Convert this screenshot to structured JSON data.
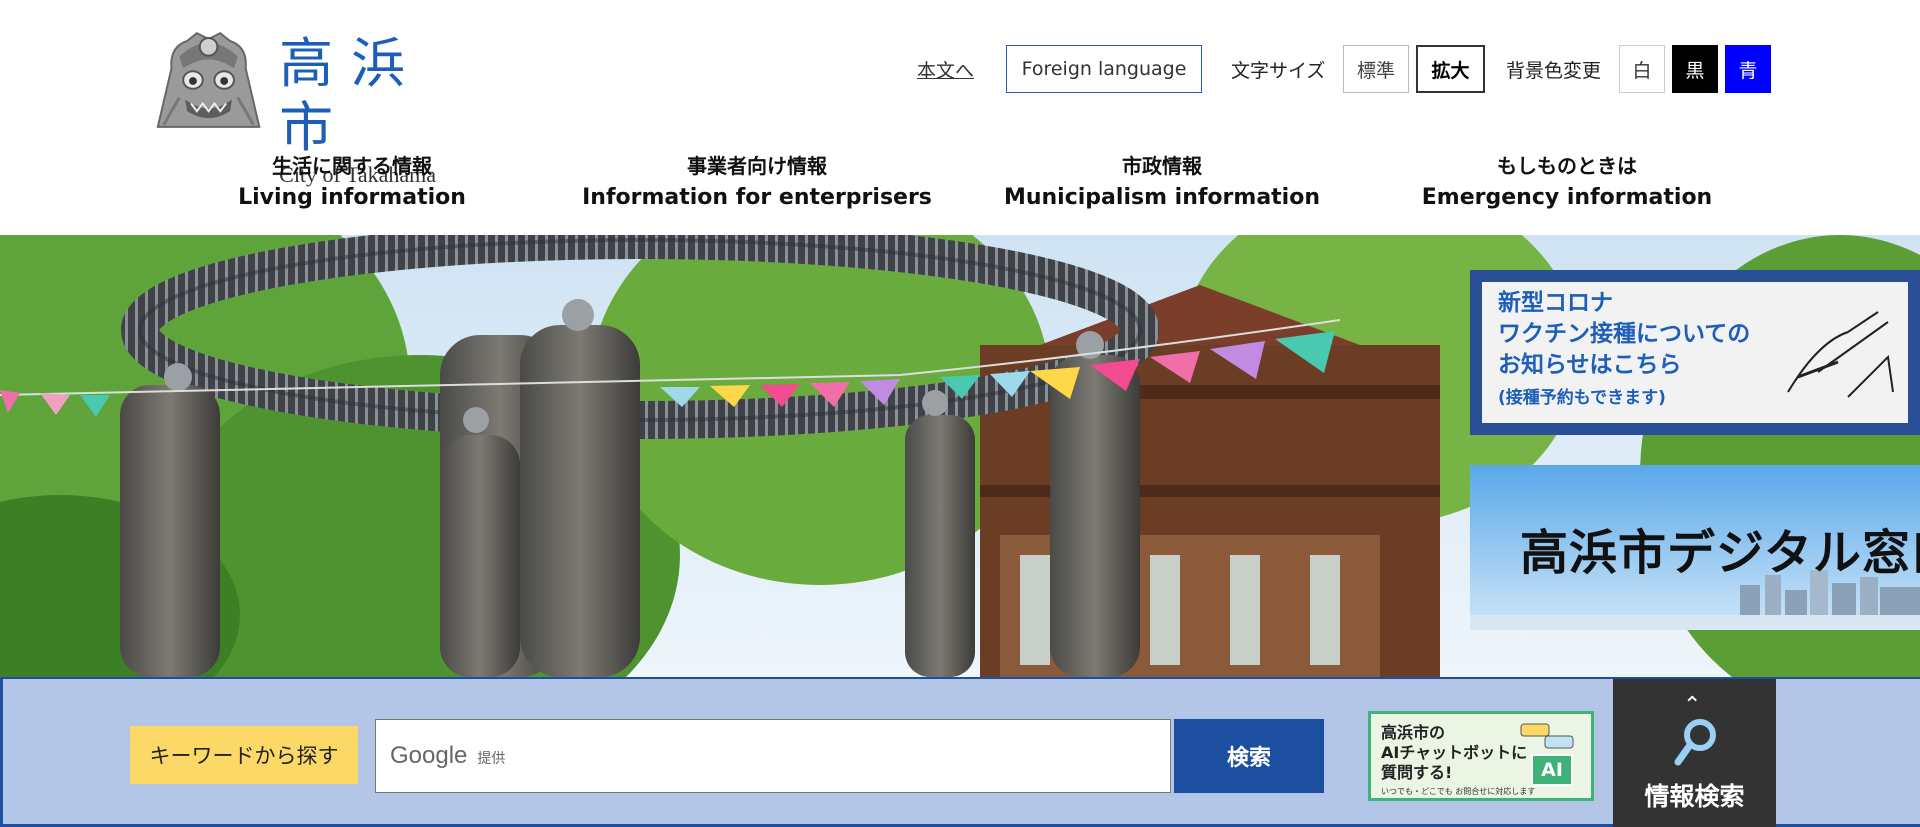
{
  "logo": {
    "title": "高浜市",
    "subtitle": "City of Takahama"
  },
  "utility": {
    "skip_link": "本文へ",
    "foreign_language": "Foreign language",
    "font_size_label": "文字サイズ",
    "font_size_standard": "標準",
    "font_size_large": "拡大",
    "bg_color_label": "背景色変更",
    "bg_white": "白",
    "bg_black": "黒",
    "bg_blue": "青"
  },
  "nav": [
    {
      "jp": "生活に関する情報",
      "en": "Living information"
    },
    {
      "jp": "事業者向け情報",
      "en": "Information for enterprisers"
    },
    {
      "jp": "市政情報",
      "en": "Municipalism information"
    },
    {
      "jp": "もしものときは",
      "en": "Emergency information"
    }
  ],
  "banners": {
    "corona": {
      "lines": [
        "新型コロナ",
        "ワクチン接種についての",
        "お知らせはこちら"
      ],
      "sub": "(接種予約もできます)"
    },
    "digital": {
      "title": "高浜市デジタル窓口"
    }
  },
  "search": {
    "label": "キーワードから探す",
    "google": "Google",
    "powered": "提供",
    "button": "検索"
  },
  "ai_banner": {
    "line1": "高浜市の",
    "line2": "AIチャットボットに",
    "line3": "質問する!",
    "small": "いつでも・どこでも お問合せに対応します",
    "badge": "AI"
  },
  "info_search": {
    "label": "情報検索"
  },
  "colors": {
    "brand_blue": "#1d5fb8",
    "search_bg": "#b3c6e8",
    "search_button": "#1d4fa0",
    "keyword_label": "#fcd967"
  }
}
